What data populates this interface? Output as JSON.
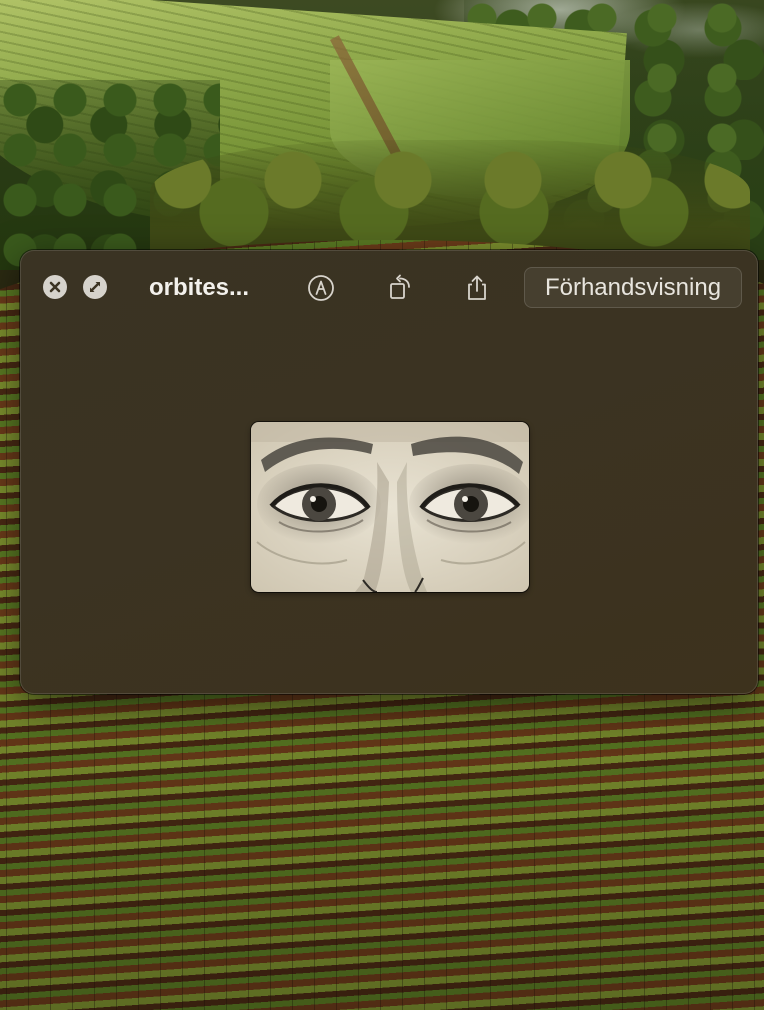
{
  "window": {
    "title": "orbites...",
    "buttons": {
      "close_icon": "close-x-icon",
      "fullscreen_icon": "fullscreen-icon",
      "markup_icon": "markup-pen-circle-icon",
      "rotate_icon": "rotate-left-icon",
      "share_icon": "share-icon",
      "open_with_label": "Förhandsvisning"
    }
  },
  "preview": {
    "image_icon": "eyes-drawing-image"
  },
  "colors": {
    "panel_bg": "#3b3322",
    "title_text": "#f3f1ec",
    "control_fill": "#d6d3cc"
  }
}
